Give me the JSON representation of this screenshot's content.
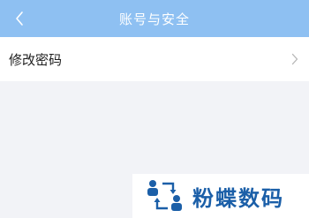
{
  "header": {
    "title": "账号与安全",
    "back_icon": "chevron-left-icon",
    "background_color": "#8ec0f2"
  },
  "settings": {
    "items": [
      {
        "label": "修改密码",
        "icon": "chevron-right-icon"
      }
    ]
  },
  "watermark": {
    "text": "粉蝶数码",
    "logo_icon": "people-exchange-logo",
    "color": "#1b5fa8"
  }
}
